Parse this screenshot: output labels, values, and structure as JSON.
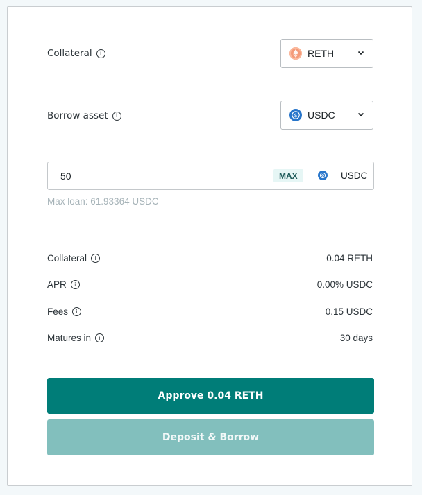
{
  "form": {
    "collateral": {
      "label": "Collateral",
      "selected": "RETH",
      "icon": "reth-token-icon"
    },
    "borrow_asset": {
      "label": "Borrow asset",
      "selected": "USDC",
      "icon": "usdc-token-icon"
    },
    "amount": {
      "value": "50",
      "max_label": "MAX",
      "token": "USDC"
    },
    "max_loan_hint": "Max loan: 61.93364 USDC"
  },
  "details": [
    {
      "label": "Collateral",
      "value": "0.04 RETH"
    },
    {
      "label": "APR",
      "value": "0.00% USDC"
    },
    {
      "label": "Fees",
      "value": "0.15 USDC"
    },
    {
      "label": "Matures in",
      "value": "30 days"
    }
  ],
  "buttons": {
    "approve": "Approve 0.04 RETH",
    "deposit_borrow": "Deposit & Borrow"
  },
  "colors": {
    "primary": "#007d78",
    "primary_disabled": "#82bfbd",
    "reth": "#f49a78",
    "usdc": "#2775ca"
  }
}
